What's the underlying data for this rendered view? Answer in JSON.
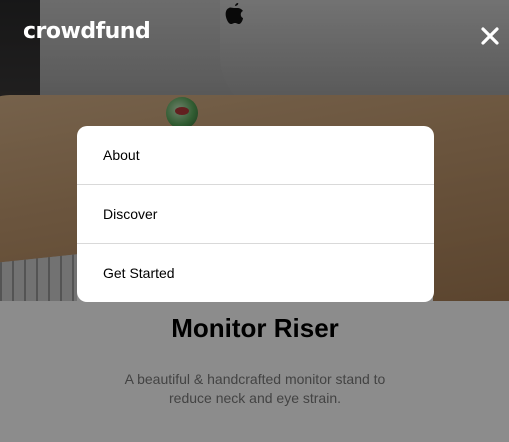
{
  "header": {
    "logo": "crowdfund",
    "close_icon": "close-icon"
  },
  "menu": {
    "items": [
      {
        "label": "About"
      },
      {
        "label": "Discover"
      },
      {
        "label": "Get Started"
      }
    ]
  },
  "product": {
    "title": "Monitor Riser",
    "description": "A beautiful & handcrafted monitor stand to reduce neck and eye strain."
  },
  "colors": {
    "overlay": "#000000",
    "menu_background": "#ffffff",
    "divider": "#d9d9d9"
  }
}
